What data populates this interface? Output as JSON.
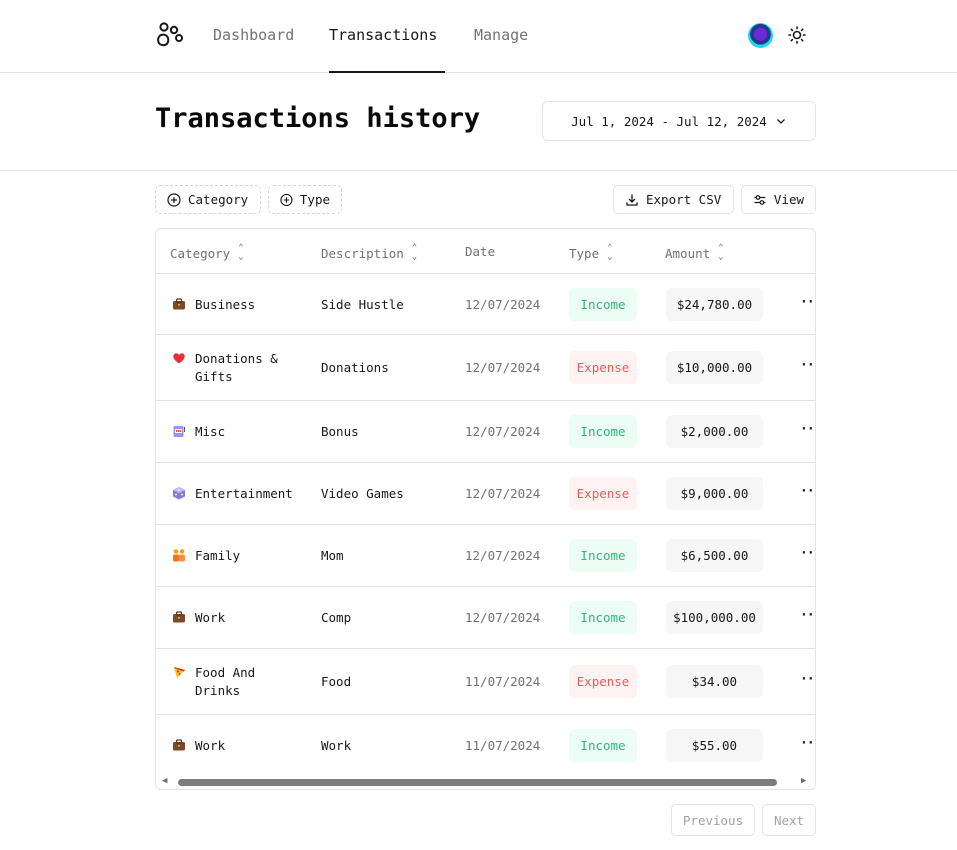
{
  "nav": {
    "items": [
      "Dashboard",
      "Transactions",
      "Manage"
    ],
    "active": "Transactions"
  },
  "header": {
    "title": "Transactions history",
    "date_range": "Jul 1, 2024 - Jul 12, 2024"
  },
  "toolbar": {
    "filter_category": "Category",
    "filter_type": "Type",
    "export_label": "Export CSV",
    "view_label": "View"
  },
  "table": {
    "columns": [
      "Category",
      "Description",
      "Date",
      "Type",
      "Amount"
    ],
    "rows": [
      {
        "icon": "briefcase-icon",
        "category": "Business",
        "description": "Side Hustle",
        "date": "12/07/2024",
        "type": "Income",
        "amount": "$24,780.00"
      },
      {
        "icon": "heart-icon",
        "category": "Donations & Gifts",
        "description": "Donations",
        "date": "12/07/2024",
        "type": "Expense",
        "amount": "$10,000.00"
      },
      {
        "icon": "slot-machine-icon",
        "category": "Misc",
        "description": "Bonus",
        "date": "12/07/2024",
        "type": "Income",
        "amount": "$2,000.00"
      },
      {
        "icon": "dice-icon",
        "category": "Entertainment",
        "description": "Video Games",
        "date": "12/07/2024",
        "type": "Expense",
        "amount": "$9,000.00"
      },
      {
        "icon": "family-icon",
        "category": "Family",
        "description": "Mom",
        "date": "12/07/2024",
        "type": "Income",
        "amount": "$6,500.00"
      },
      {
        "icon": "briefcase-icon",
        "category": "Work",
        "description": "Comp",
        "date": "12/07/2024",
        "type": "Income",
        "amount": "$100,000.00"
      },
      {
        "icon": "pizza-icon",
        "category": "Food And Drinks",
        "description": "Food",
        "date": "11/07/2024",
        "type": "Expense",
        "amount": "$34.00"
      },
      {
        "icon": "briefcase-icon",
        "category": "Work",
        "description": "Work",
        "date": "11/07/2024",
        "type": "Income",
        "amount": "$55.00"
      }
    ]
  },
  "pagination": {
    "previous": "Previous",
    "next": "Next"
  },
  "colors": {
    "income_text": "#34b27b",
    "income_bg": "#ecfdf5",
    "expense_text": "#ef5b5b",
    "expense_bg": "#fef2f2"
  }
}
